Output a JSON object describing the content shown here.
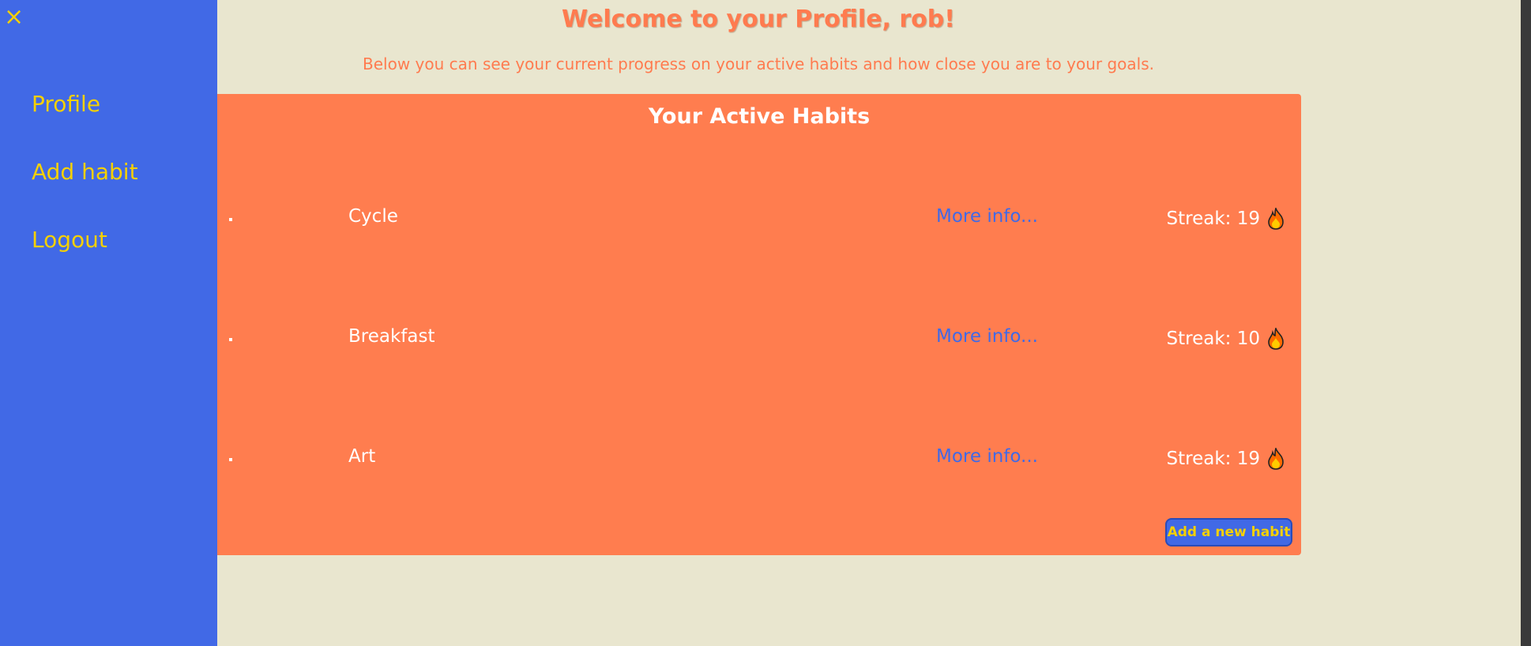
{
  "sidebar": {
    "close_label": "×",
    "items": [
      {
        "label": "Profile"
      },
      {
        "label": "Add habit"
      },
      {
        "label": "Logout"
      }
    ]
  },
  "header": {
    "title": "Welcome to your Profile, rob!",
    "subtitle": "Below you can see your current progress on your active habits and how close you are to your goals."
  },
  "habits_panel": {
    "title": "Your Active Habits",
    "habits": [
      {
        "name": "Cycle",
        "more_info": "More info...",
        "streak": "Streak: 19"
      },
      {
        "name": "Breakfast",
        "more_info": "More info...",
        "streak": "Streak: 10"
      },
      {
        "name": "Art",
        "more_info": "More info...",
        "streak": "Streak: 19"
      }
    ],
    "add_button": "Add a new habit"
  },
  "icons": {
    "streak": "fire-icon",
    "close": "close-icon"
  },
  "colors": {
    "sidebar": "#4169e6",
    "accent_yellow": "#f5d000",
    "panel_orange": "#ff7d4f",
    "background": "#e9e6cf"
  }
}
